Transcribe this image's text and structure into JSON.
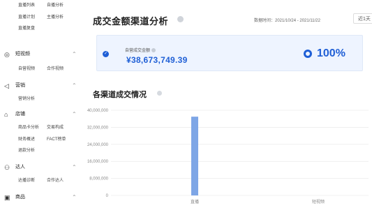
{
  "sidebar": {
    "top_rows": [
      {
        "items": [
          "直播列表",
          "自播分析"
        ]
      },
      {
        "items": [
          "直播计划",
          "主播分析"
        ]
      },
      {
        "items": [
          "直播复盘"
        ]
      }
    ],
    "groups": [
      {
        "icon": "target-icon",
        "icon_char": "◎",
        "label": "短视频",
        "items": [
          "自营视频",
          "合作视频"
        ]
      },
      {
        "icon": "megaphone-icon",
        "icon_char": "◁",
        "label": "营销",
        "items": [
          "营销分析"
        ]
      },
      {
        "icon": "store-icon",
        "icon_char": "⌂",
        "label": "店铺",
        "items": [
          "商品卡分析",
          "交易构成",
          "财务概述",
          "FACT榜单",
          "退款分析"
        ]
      },
      {
        "icon": "person-icon",
        "icon_char": "⚇",
        "label": "达人",
        "items": [
          "达播诊断",
          "合作达人"
        ]
      },
      {
        "icon": "goods-icon",
        "icon_char": "▣",
        "label": "商品",
        "items": []
      }
    ]
  },
  "header": {
    "title": "成交金额渠道分析",
    "date_range": "数据时间：2021/10/24 - 2021/11/22",
    "date_button": "近1天"
  },
  "stat_card": {
    "label": "自营成交金额",
    "value": "¥38,673,749.39",
    "percent": "100%"
  },
  "section": {
    "title": "各渠道成交情况"
  },
  "colors": {
    "accent": "#1f5fd6",
    "bar": "#7ea6e6",
    "grid": "#e6e6e6"
  },
  "chart_data": {
    "type": "bar",
    "categories": [
      "直播",
      "短视频"
    ],
    "values": [
      37000000,
      0
    ],
    "y_ticks": [
      "40,000,000",
      "32,000,000",
      "24,000,000",
      "16,000,000",
      "8,000,000",
      "0"
    ],
    "ylim": [
      0,
      40000000
    ],
    "grid": true,
    "title": "",
    "xlabel": "",
    "ylabel": ""
  }
}
